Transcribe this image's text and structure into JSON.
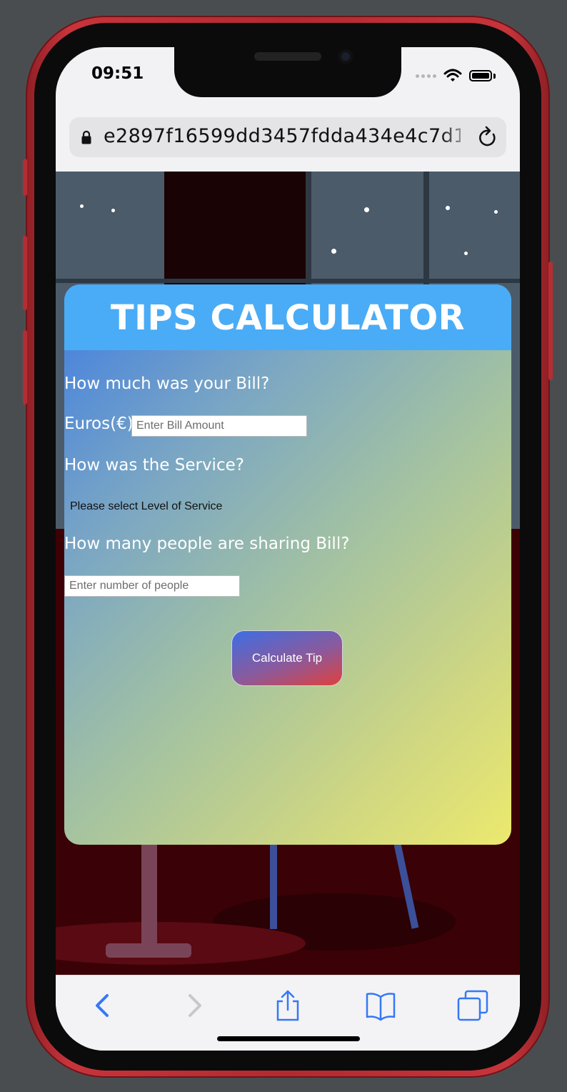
{
  "status_bar": {
    "time": "09:51"
  },
  "browser": {
    "url": "e2897f16599dd3457fdda434e4c7d1("
  },
  "app": {
    "title": "TIPS CALCULATOR",
    "bill_question": "How much was your Bill?",
    "currency_label": "Euros(€)",
    "bill_placeholder": "Enter Bill Amount",
    "service_question": "How was the Service?",
    "service_select_value": "Please select Level of Service",
    "people_question": "How many people are sharing Bill?",
    "people_placeholder": "Enter number of people",
    "calculate_button": "Calculate Tip"
  },
  "toolbar": {
    "icons": [
      "back-icon",
      "forward-icon",
      "share-icon",
      "bookmarks-icon",
      "tabs-icon"
    ]
  },
  "colors": {
    "header": "#4aacf6",
    "phone_frame": "#b22a30",
    "accent_blue": "#3478f6"
  }
}
